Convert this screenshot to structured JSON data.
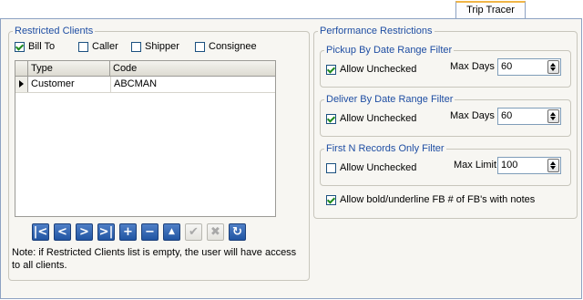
{
  "tab": {
    "label": "Trip Tracer"
  },
  "restricted": {
    "legend": "Restricted Clients",
    "checkboxes": [
      {
        "label": "Bill To",
        "checked": true
      },
      {
        "label": "Caller",
        "checked": false
      },
      {
        "label": "Shipper",
        "checked": false
      },
      {
        "label": "Consignee",
        "checked": false
      }
    ],
    "grid": {
      "columns": [
        "Type",
        "Code"
      ],
      "rows": [
        {
          "type": "Customer",
          "code": "ABCMAN"
        }
      ]
    },
    "nav_buttons": [
      {
        "icon": "first-record-icon",
        "glyph": "|<",
        "enabled": true
      },
      {
        "icon": "prior-record-icon",
        "glyph": "<",
        "enabled": true
      },
      {
        "icon": "next-record-icon",
        "glyph": ">",
        "enabled": true
      },
      {
        "icon": "last-record-icon",
        "glyph": ">|",
        "enabled": true
      },
      {
        "icon": "insert-record-icon",
        "glyph": "+",
        "enabled": true
      },
      {
        "icon": "delete-record-icon",
        "glyph": "−",
        "enabled": true
      },
      {
        "icon": "edit-record-icon",
        "glyph": "▲",
        "enabled": true
      },
      {
        "icon": "post-edit-icon",
        "glyph": "✔",
        "enabled": false
      },
      {
        "icon": "cancel-edit-icon",
        "glyph": "✖",
        "enabled": false
      },
      {
        "icon": "refresh-icon",
        "glyph": "↻",
        "enabled": true
      }
    ],
    "note": "Note: if Restricted Clients list is empty, the user will have access to all clients."
  },
  "performance": {
    "legend": "Performance Restrictions",
    "pickup": {
      "legend": "Pickup By Date Range Filter",
      "allow_label": "Allow Unchecked",
      "allow_checked": true,
      "limit_label": "Max Days",
      "limit_value": "60"
    },
    "deliver": {
      "legend": "Deliver By Date Range Filter",
      "allow_label": "Allow Unchecked",
      "allow_checked": true,
      "limit_label": "Max Days",
      "limit_value": "60"
    },
    "firstn": {
      "legend": "First N Records Only Filter",
      "allow_label": "Allow Unchecked",
      "allow_checked": false,
      "limit_label": "Max Limit",
      "limit_value": "100"
    },
    "bold_label": "Allow bold/underline FB # of FB's with notes",
    "bold_checked": true
  },
  "colors": {
    "accent": "#1f4ea3",
    "tab_highlight": "#f0b548",
    "nav_blue": "#2155a3",
    "check_green": "#1e8a1e"
  }
}
